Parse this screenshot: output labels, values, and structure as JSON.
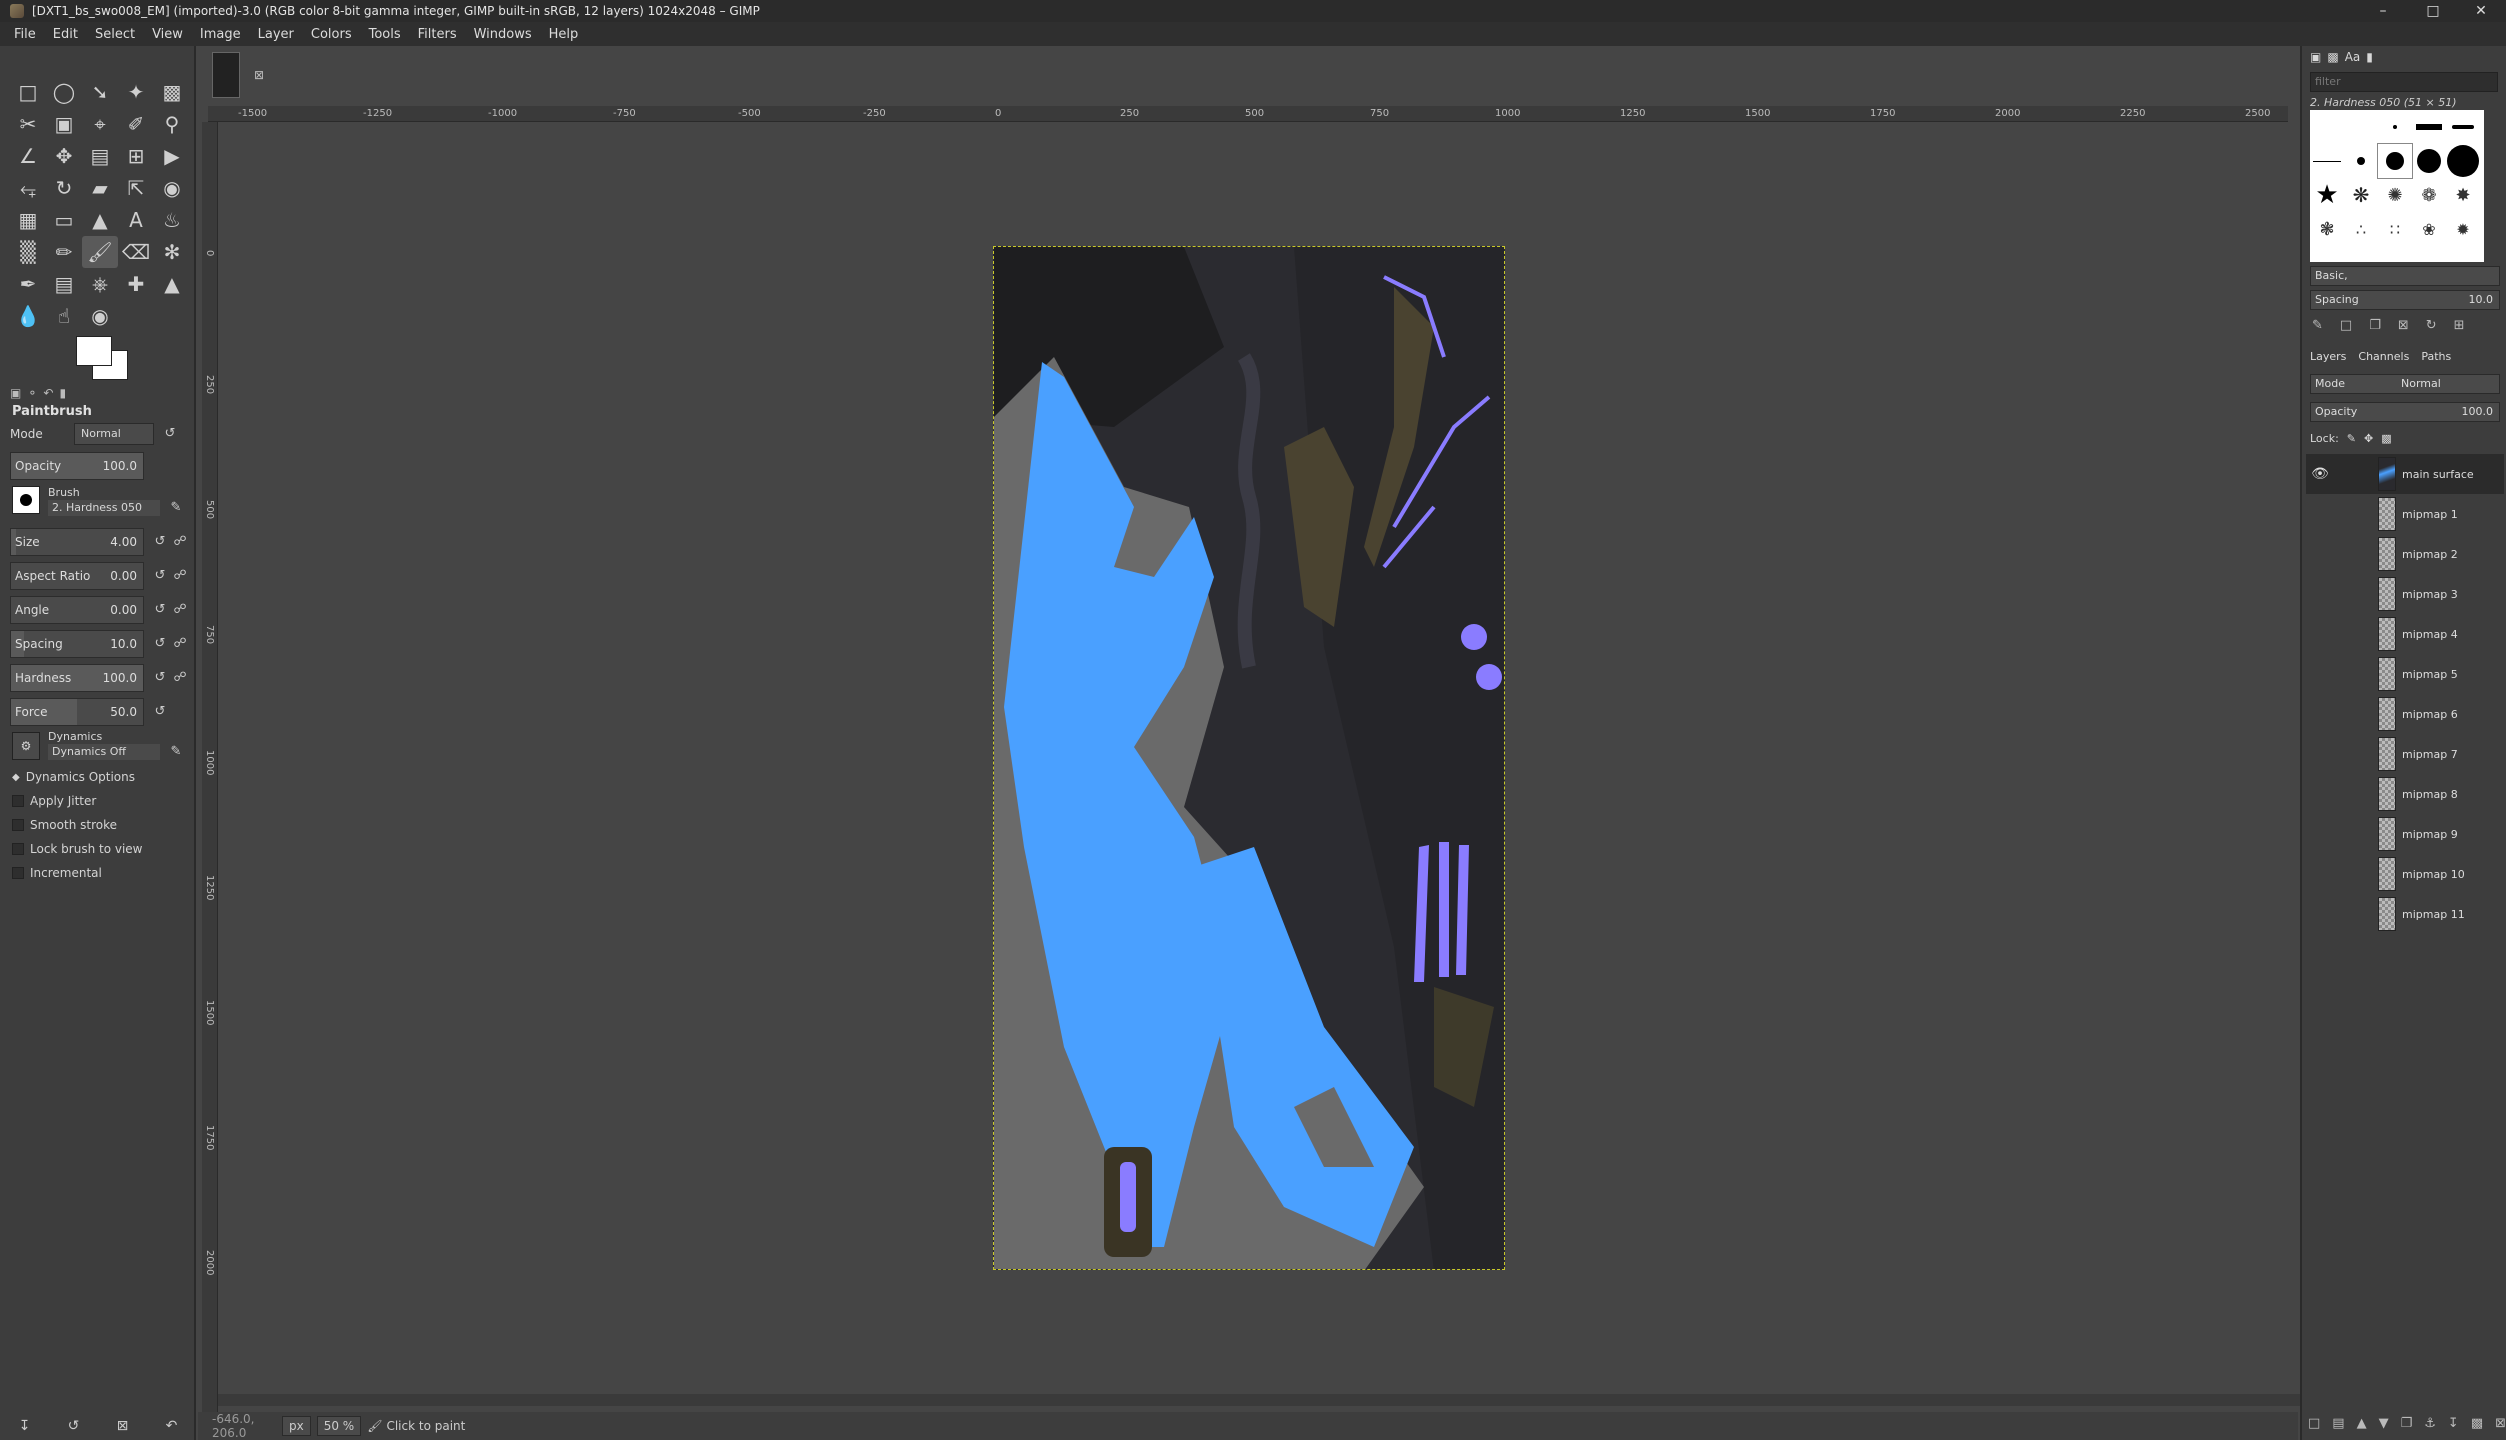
{
  "window": {
    "title": "[DXT1_bs_swo008_EM] (imported)-3.0 (RGB color 8-bit gamma integer, GIMP built-in sRGB, 12 layers) 1024x2048 – GIMP"
  },
  "menubar": [
    "File",
    "Edit",
    "Select",
    "View",
    "Image",
    "Layer",
    "Colors",
    "Tools",
    "Filters",
    "Windows",
    "Help"
  ],
  "tool_options": {
    "title": "Paintbrush",
    "mode_label": "Mode",
    "mode_value": "Normal",
    "opacity_label": "Opacity",
    "opacity_value": "100.0",
    "brush_label": "Brush",
    "brush_value": "2. Hardness 050",
    "size_label": "Size",
    "size_value": "4.00",
    "aspect_label": "Aspect Ratio",
    "aspect_value": "0.00",
    "angle_label": "Angle",
    "angle_value": "0.00",
    "spacing_label": "Spacing",
    "spacing_value": "10.0",
    "hardness_label": "Hardness",
    "hardness_value": "100.0",
    "force_label": "Force",
    "force_value": "50.0",
    "dynamics_label": "Dynamics",
    "dynamics_value": "Dynamics Off",
    "dynamics_options": "Dynamics Options",
    "apply_jitter": "Apply Jitter",
    "smooth_stroke": "Smooth stroke",
    "lock_brush": "Lock brush to view",
    "incremental": "Incremental"
  },
  "ruler_h": [
    "-1500",
    "-1250",
    "-1000",
    "-750",
    "-500",
    "-250",
    "0",
    "250",
    "500",
    "750",
    "1000",
    "1250",
    "1500",
    "1750",
    "2000",
    "2250",
    "2500"
  ],
  "ruler_v": [
    "0",
    "250",
    "500",
    "750",
    "1000",
    "1250",
    "1500",
    "1750",
    "2000"
  ],
  "status": {
    "coords": "-646.0, 206.0",
    "unit": "px",
    "zoom": "50 %",
    "message": "Click to paint"
  },
  "brushes": {
    "filter_placeholder": "filter",
    "selected_name": "2. Hardness 050 (51 × 51)",
    "preset": "Basic,",
    "spacing_label": "Spacing",
    "spacing_value": "10.0"
  },
  "layers_panel": {
    "tabs": [
      "Layers",
      "Channels",
      "Paths"
    ],
    "mode_label": "Mode",
    "mode_value": "Normal",
    "opacity_label": "Opacity",
    "opacity_value": "100.0",
    "lock_label": "Lock:",
    "layers": [
      "main surface",
      "mipmap 1",
      "mipmap 2",
      "mipmap 3",
      "mipmap 4",
      "mipmap 5",
      "mipmap 6",
      "mipmap 7",
      "mipmap 8",
      "mipmap 9",
      "mipmap 10",
      "mipmap 11"
    ]
  },
  "colors": {
    "accent_blue": "#4aa0ff",
    "accent_violet": "#8a7cff",
    "canvas_bg": "#454545"
  }
}
